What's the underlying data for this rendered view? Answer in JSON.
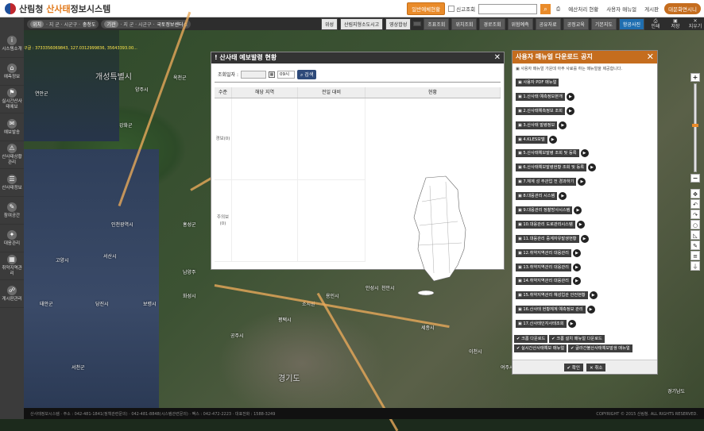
{
  "header": {
    "logo_forest": "산림청",
    "logo_system_a": "산사태",
    "logo_system_b": "정보시스템",
    "btn_report": "일반예체현황",
    "chk_label": "신고조회",
    "links": [
      "예산처리 현황",
      "사용자 매뉴얼",
      "게시판"
    ],
    "btn_main": "대문화면시니"
  },
  "toolbar": {
    "loc1_label": "위치",
    "loc1_val": "· 지 군 · 시군구 ·",
    "loc1_city": "충청도",
    "loc2_label": "기관",
    "loc2_val": "· 지 군 · 시군구 ·",
    "loc2_org": "국토정보센터스",
    "btns": [
      "위성",
      "산림지형소도시고",
      "영상합성",
      "",
      "조표조회",
      "위치조회",
      "경로조회",
      "위험예측",
      "공유자료",
      "공정교육",
      "기본지도",
      "항공사진"
    ],
    "icons": [
      "인쇄",
      "저장",
      "지우기"
    ]
  },
  "sidebar": {
    "items": [
      {
        "icon": "i",
        "label": "시스템소개"
      },
      {
        "icon": "⌂",
        "label": "예측정보"
      },
      {
        "icon": "⚑",
        "label": "실시간산사태예보"
      },
      {
        "icon": "✉",
        "label": "예보발송"
      },
      {
        "icon": "⚠",
        "label": "산사태상황관리"
      },
      {
        "icon": "☰",
        "label": "산사태정보"
      },
      {
        "icon": "✎",
        "label": "참여공간"
      },
      {
        "icon": "✦",
        "label": "대응관리"
      },
      {
        "icon": "▦",
        "label": "취약지역관리"
      },
      {
        "icon": "☍",
        "label": "게시판관리"
      }
    ]
  },
  "map": {
    "coord": "구글 : 3733356069843, 127.0312999836, 35643393.00...",
    "places": [
      "개성특별시",
      "연안군",
      "양주시",
      "옥천군",
      "강화군",
      "인천광역시",
      "화성시",
      "평택시",
      "용인시",
      "안성시",
      "천안시",
      "세종시",
      "경기도",
      "조치원",
      "고양시",
      "남양주",
      "이천시",
      "여주시",
      "원주시",
      "충주시",
      "당진시",
      "서산시",
      "태안군",
      "서천군",
      "보령시",
      "홍성군",
      "공주시",
      "경기남도"
    ]
  },
  "bottom": {
    "left": "산사태정보시스템 · 주소 : 042-481-1841(정책관련문의) · 042-481-8848(시스템관련문의) · 팩스 : 042-472-2223 · 대표전화 : 1588-3249",
    "right": "COPYRIGHT © 2015 산림청. ALL RIGHTS RESERVED."
  },
  "panel1": {
    "title": "! 산사태 예보발령 현황",
    "filter_label": "조회일자 :",
    "date_value": "",
    "select": "09시",
    "search_btn": "검색",
    "cols": [
      "수준",
      "해당 지역",
      "전일 대비",
      "현황"
    ],
    "rows": [
      {
        "level": "경보(0)"
      },
      {
        "level": "주의보(0)"
      }
    ]
  },
  "panel2": {
    "title": "사용자 매뉴얼 다운로드 공지",
    "desc": "▣ 사용자 매뉴얼 가운데 아주 사료를 하는 매뉴얼을 제공합니다.",
    "items": [
      "사용자 PDF 매뉴얼",
      "1.산사태 예측정보본개",
      "2.산사태예측정보 조회",
      "3.산사태 발령정보",
      "4.KLES모델",
      "5.산사태예보발령 조회 및 등록",
      "6.산사태예보발령현황 조회 및 등록",
      "7.체계 성 주관업 전 경과하기",
      "8.대응관리 시스템",
      "9.대응관리 정찰방사시스템",
      "10.대응관리 도로관리시스템",
      "11.대응관리 중계자유발생현황",
      "12.취약지역관리 대응관리",
      "13.취약지역관리 대응관리",
      "14.취약지역관리 대응관리",
      "15.취약지역관리 혜성업관 안전현황",
      "16.산사태 현황체계 예측정보 관리",
      "17.산사태인지사태조회"
    ],
    "tabs": [
      [
        "크롬 다운로드",
        "크롬 설치 매뉴얼 다운로드"
      ],
      [
        "실시간산사태예보 매뉴얼",
        "글라간불산사태예보발생 매뉴얼"
      ]
    ],
    "ok": "확인",
    "cancel": "취소"
  }
}
